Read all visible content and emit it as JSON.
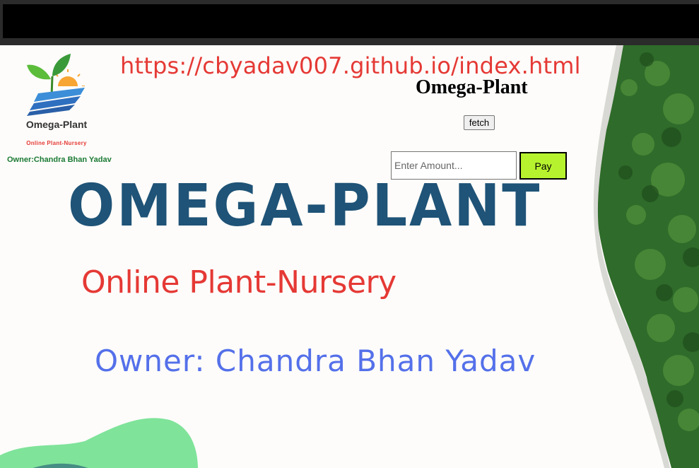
{
  "logo": {
    "title": "Omega-Plant",
    "subtitle": "Online Plant-Nursery",
    "owner": "Owner:Chandra Bhan Yadav"
  },
  "header": {
    "url": "https://cbyadav007.github.io/index.html",
    "site_title": "Omega-Plant",
    "fetch_label": "fetch"
  },
  "payment": {
    "amount_placeholder": "Enter Amount...",
    "pay_label": "Pay"
  },
  "hero": {
    "brand": "OMEGA-PLANT",
    "tagline": "Online Plant-Nursery",
    "owner": "Owner: Chandra Bhan Yadav"
  },
  "colors": {
    "brand_blue": "#1f5377",
    "tagline_red": "#e53935",
    "owner_blue": "#5470ea",
    "pay_green": "#b6f22e",
    "forest_green": "#2f6b2a",
    "blob_green": "#7fe39a"
  }
}
